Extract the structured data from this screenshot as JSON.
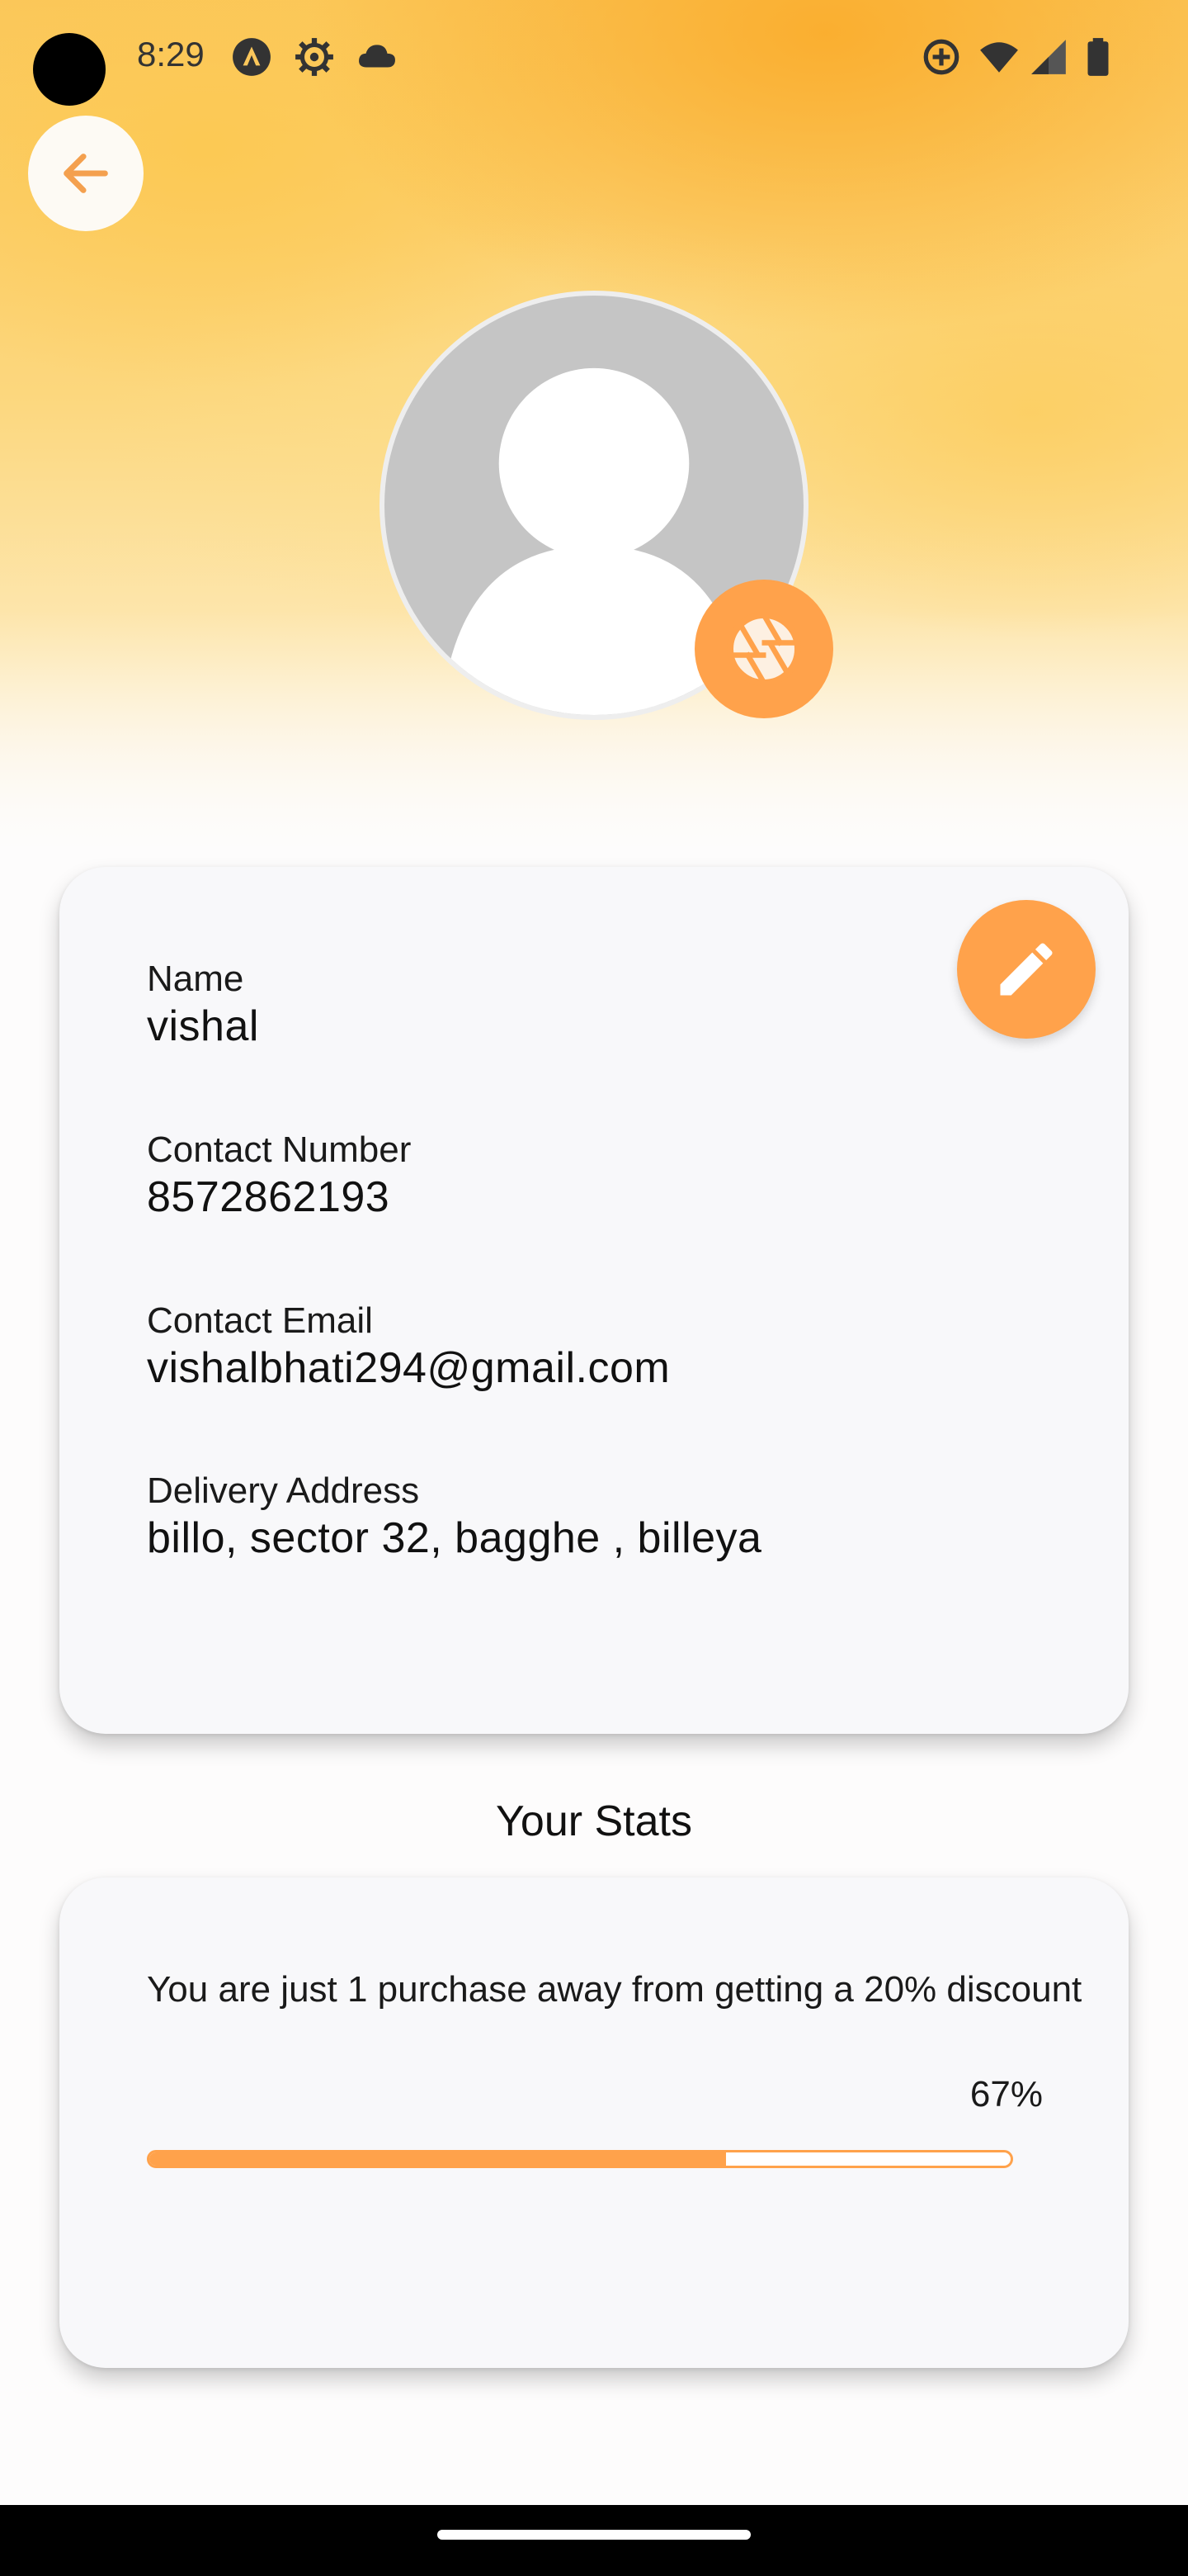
{
  "status_bar": {
    "time": "8:29",
    "icons": [
      "android-auto-icon",
      "settings-gear-icon",
      "cloud-icon",
      "data-saver-icon",
      "wifi-icon",
      "cell-signal-icon",
      "battery-icon"
    ]
  },
  "header": {
    "back_icon": "arrow-left-icon",
    "camera_icon": "camera-aperture-icon"
  },
  "profile": {
    "edit_icon": "pencil-icon",
    "fields": [
      {
        "label": "Name",
        "value": "vishal"
      },
      {
        "label": "Contact Number",
        "value": "8572862193"
      },
      {
        "label": "Contact Email",
        "value": "vishalbhati294@gmail.com"
      },
      {
        "label": "Delivery Address",
        "value": "billo, sector 32, bagghe , billeya"
      }
    ]
  },
  "stats": {
    "title": "Your Stats",
    "message": "You are just 1 purchase away from getting a 20% discount",
    "percent_label": "67%",
    "progress": 0.67
  },
  "colors": {
    "accent": "#ffa24b",
    "card_bg": "#f8f8fa",
    "avatar_bg": "#c5c5c5"
  }
}
